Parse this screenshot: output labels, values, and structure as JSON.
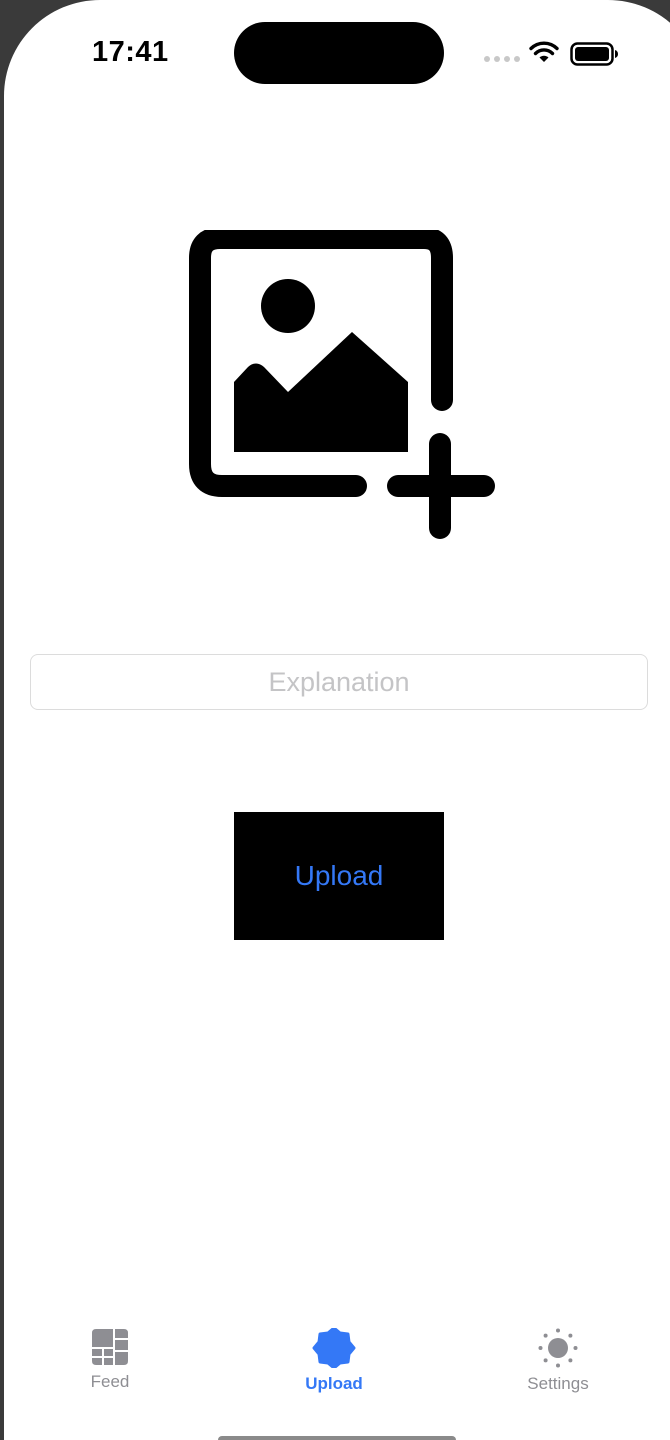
{
  "status_bar": {
    "time": "17:41"
  },
  "main": {
    "add_photo_icon": "photo-badge-plus-icon",
    "explanation": {
      "value": "",
      "placeholder": "Explanation"
    },
    "upload_button_label": "Upload"
  },
  "tab_bar": {
    "tabs": [
      {
        "label": "Feed",
        "icon": "grid-icon",
        "selected": false
      },
      {
        "label": "Upload",
        "icon": "badge-icon",
        "selected": true
      },
      {
        "label": "Settings",
        "icon": "sun-icon",
        "selected": false
      }
    ]
  },
  "colors": {
    "accent": "#3478f6",
    "inactive_tab": "#8e8e93",
    "button_background": "#000000",
    "placeholder": "#c4c4c6"
  }
}
